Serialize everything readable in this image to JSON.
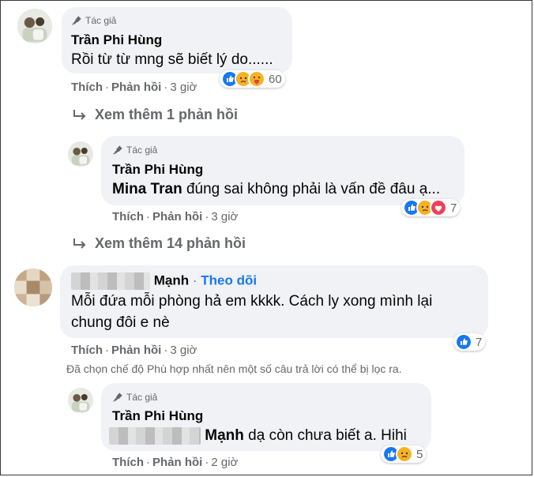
{
  "author_badge": "Tác giả",
  "actions": {
    "like": "Thích",
    "reply": "Phản hồi",
    "sep": "·"
  },
  "colors": {
    "like": "#1877f2",
    "link": "#1877f2",
    "bubble": "#f0f2f5",
    "muted": "#65676b"
  },
  "comments": [
    {
      "name": "Trần Phi Hùng",
      "text": "Rồi từ từ mng sẽ biết lý do......",
      "time": "3 giờ",
      "reactions": [
        "like-icon",
        "sad-icon",
        "care-icon"
      ],
      "count": "60"
    },
    {
      "name": "Trần Phi Hùng",
      "mention": "Mina Tran",
      "text": " đúng sai không phải là vấn đề đâu ạ...",
      "time": "3 giờ",
      "reactions": [
        "like-icon",
        "sad-icon",
        "love-icon"
      ],
      "count": "7"
    },
    {
      "name": "Mạnh",
      "follow": "Theo dõi",
      "text_line1": "Mỗi đứa mỗi phòng hả em kkkk. Cách ly xong mình lại",
      "text_line2": "chung đôi e nè",
      "time": "3 giờ",
      "reactions": [
        "like-icon"
      ],
      "count": "7"
    },
    {
      "name": "Trần Phi Hùng",
      "mention": "Mạnh",
      "text": " dạ còn chưa biết a. Hihi",
      "time": "2 giờ",
      "reactions": [
        "like-icon",
        "sad-icon"
      ],
      "count": "5"
    }
  ],
  "view_more_1": "Xem thêm 1 phản hồi",
  "view_more_2": "Xem thêm 14 phản hồi",
  "filter_notice": "Đã chọn chế độ Phù hợp nhất nên một số câu trả lời có thể bị lọc ra."
}
